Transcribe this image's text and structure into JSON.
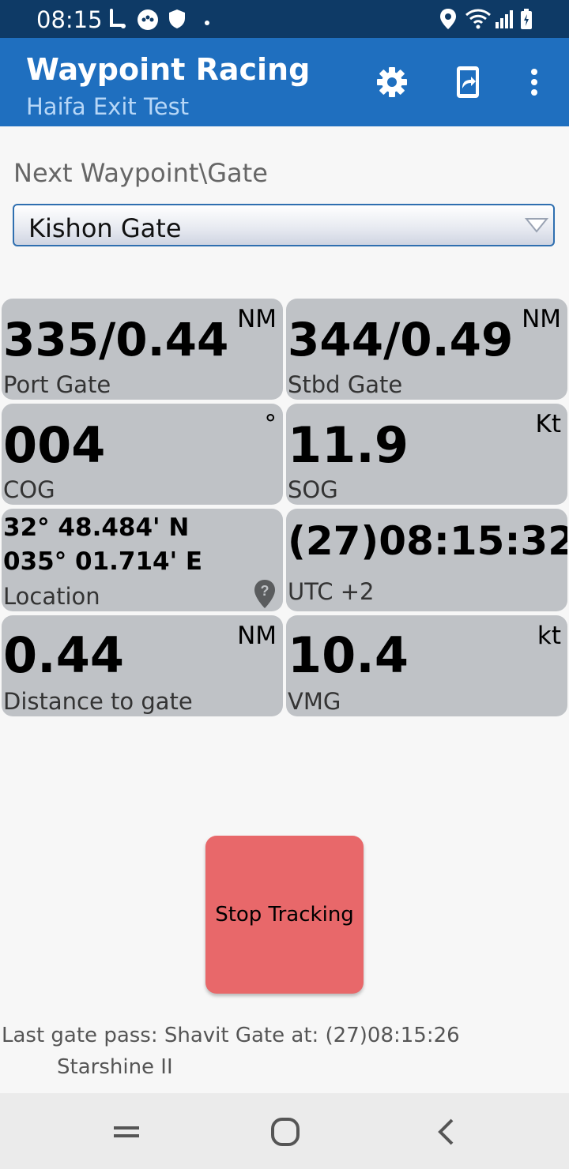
{
  "status_bar": {
    "time": "08:15",
    "left_icons": [
      "tracking-app-icon",
      "gps-dots-icon",
      "shield-icon",
      "dot-icon"
    ],
    "right_icons": [
      "location-pin-icon",
      "wifi-icon",
      "signal-icon",
      "battery-icon"
    ]
  },
  "app_bar": {
    "title": "Waypoint Racing",
    "subtitle": "Haifa Exit Test",
    "actions": [
      "gear-icon",
      "share-icon",
      "more-vert-icon"
    ],
    "background": "#1f6fbf"
  },
  "next_waypoint": {
    "label": "Next Waypoint\\Gate",
    "selected": "Kishon Gate"
  },
  "tiles": {
    "port_gate": {
      "value": "335/0.44",
      "unit": "NM",
      "label": "Port Gate"
    },
    "stbd_gate": {
      "value": "344/0.49",
      "unit": "NM",
      "label": "Stbd Gate"
    },
    "cog": {
      "value": "004",
      "unit": "°",
      "label": "COG"
    },
    "sog": {
      "value": "11.9",
      "unit": "Kt",
      "label": "SOG"
    },
    "location": {
      "lat": "32° 48.484' N",
      "lon": "035° 01.714' E",
      "label": "Location"
    },
    "time": {
      "value": "(27)08:15:32",
      "label": "UTC +2"
    },
    "distance": {
      "value": "0.44",
      "unit": "NM",
      "label": "Distance to gate"
    },
    "vmg": {
      "value": "10.4",
      "unit": "kt",
      "label": "VMG"
    },
    "tile_color": "#bfc2c6"
  },
  "stop_button": {
    "label": "Stop Tracking",
    "color": "#e8686a"
  },
  "footer": {
    "last_gate_pass": "Last gate pass: Shavit Gate at: (27)08:15:26",
    "boat_name": "Starshine II"
  },
  "nav_bar": {
    "buttons": [
      "recents-icon",
      "home-icon",
      "back-icon"
    ]
  }
}
